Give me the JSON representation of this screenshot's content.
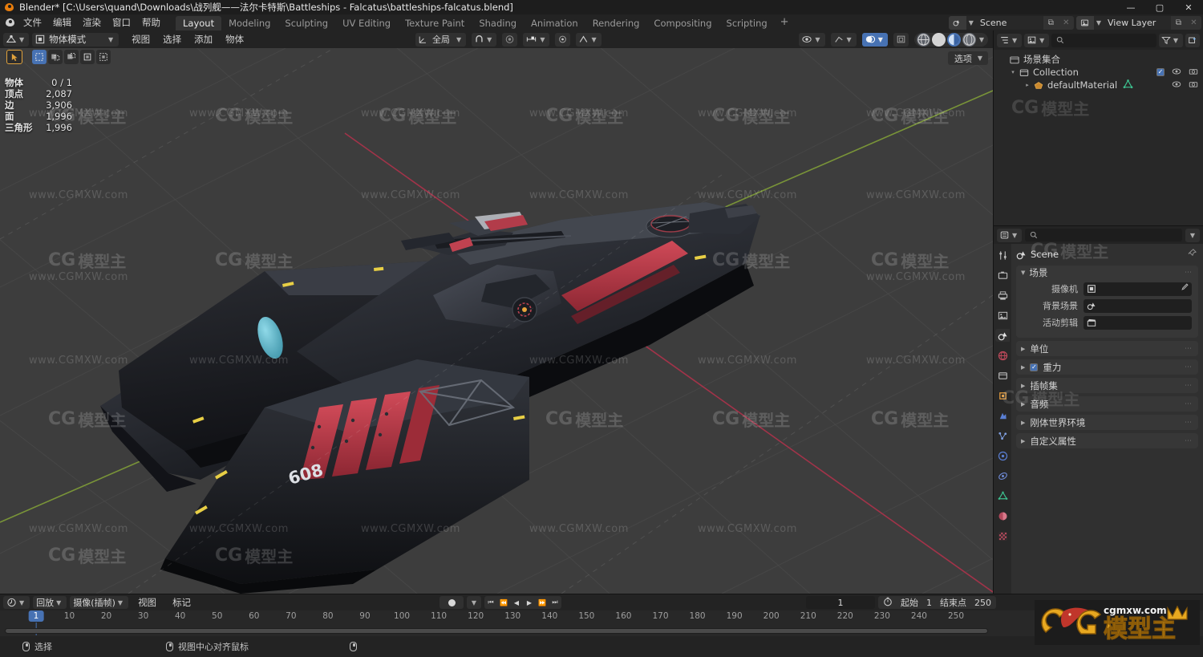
{
  "window": {
    "title": "Blender* [C:\\Users\\quand\\Downloads\\战列舰——法尔卡特斯\\Battleships - Falcatus\\battleships-falcatus.blend]",
    "minimize": "—",
    "maximize": "▢",
    "close": "✕"
  },
  "topbar": {
    "menus": [
      "文件",
      "编辑",
      "渲染",
      "窗口",
      "帮助"
    ],
    "workspaces": [
      {
        "label": "Layout",
        "active": true
      },
      {
        "label": "Modeling",
        "active": false
      },
      {
        "label": "Sculpting",
        "active": false
      },
      {
        "label": "UV Editing",
        "active": false
      },
      {
        "label": "Texture Paint",
        "active": false
      },
      {
        "label": "Shading",
        "active": false
      },
      {
        "label": "Animation",
        "active": false
      },
      {
        "label": "Rendering",
        "active": false
      },
      {
        "label": "Compositing",
        "active": false
      },
      {
        "label": "Scripting",
        "active": false
      }
    ],
    "add_workspace": "+",
    "scene_name": "Scene",
    "view_layer_name": "View Layer",
    "new_scene_label": "⧉",
    "unlink_label": "✕"
  },
  "viewport": {
    "mode": "物体模式",
    "menus": [
      "视图",
      "选择",
      "添加",
      "物体"
    ],
    "transform_orientation": "全局",
    "options_label": "选项",
    "stats": [
      {
        "key": "物体",
        "value": "0 / 1"
      },
      {
        "key": "顶点",
        "value": "2,087"
      },
      {
        "key": "边",
        "value": "3,906"
      },
      {
        "key": "面",
        "value": "1,996"
      },
      {
        "key": "三角形",
        "value": "1,996"
      }
    ],
    "shading_modes": [
      "wireframe",
      "solid",
      "material-preview",
      "rendered"
    ],
    "active_shading": "solid"
  },
  "outliner": {
    "search_placeholder": "",
    "rows": [
      {
        "name": "场景集合",
        "icon": "scene-collection-icon",
        "indent": 0,
        "tri": "",
        "has_toggles": false
      },
      {
        "name": "Collection",
        "icon": "collection-icon",
        "indent": 1,
        "tri": "▾",
        "has_toggles": true,
        "checkbox": true
      },
      {
        "name": "defaultMaterial",
        "icon": "mesh-object-icon",
        "indent": 2,
        "tri": "▸",
        "has_toggles": true,
        "checkbox": false
      }
    ],
    "eye_icon": "👁",
    "camera_icon": "📷",
    "filter_icon": "filter-icon",
    "new_collection_icon": "new-collection-icon"
  },
  "properties": {
    "search_placeholder": "",
    "breadcrumb": "Scene",
    "tabs": [
      "tool",
      "render",
      "output",
      "view-layer",
      "scene",
      "world",
      "collection",
      "object",
      "modifier",
      "particles",
      "physics",
      "constraints",
      "data",
      "material",
      "texture"
    ],
    "active_tab": "scene",
    "scene_panel": {
      "title": "场景",
      "fields": [
        {
          "label": "摄像机",
          "value": "",
          "icon": "camera-data-icon"
        },
        {
          "label": "背景场景",
          "value": "",
          "icon": "scene-icon"
        },
        {
          "label": "活动剪辑",
          "value": "",
          "icon": "clip-icon"
        }
      ]
    },
    "collapsed_panels": [
      {
        "label": "单位",
        "checkbox": false
      },
      {
        "label": "重力",
        "checkbox": true
      },
      {
        "label": "插帧集",
        "checkbox": false
      },
      {
        "label": "音频",
        "checkbox": false
      },
      {
        "label": "刚体世界环境",
        "checkbox": false
      },
      {
        "label": "自定义属性",
        "checkbox": false
      }
    ]
  },
  "timeline": {
    "editor_icon": "timeline-icon",
    "playback_label": "回放",
    "keying_label": "摄像(插帧)",
    "menus": [
      "视图",
      "标记"
    ],
    "transport": [
      "⏮",
      "⏪",
      "◀",
      "▶",
      "⏩",
      "⏭"
    ],
    "current_frame": "1",
    "start_label": "起始",
    "start_value": "1",
    "end_label": "结束点",
    "end_value": "250",
    "ruler_ticks": [
      10,
      20,
      30,
      40,
      50,
      60,
      70,
      80,
      90,
      100,
      110,
      120,
      130,
      140,
      150,
      160,
      170,
      180,
      190,
      200,
      210,
      220,
      230,
      240,
      250
    ],
    "playhead_frame": "1"
  },
  "statusbar": {
    "items": [
      {
        "mouse": "left",
        "label": "选择"
      },
      {
        "mouse": "middle",
        "label": "视图中心对齐鼠标"
      },
      {
        "mouse": "right",
        "label": ""
      }
    ]
  },
  "watermark": {
    "text": "www.CGMXW.com",
    "brand_cg": "CG",
    "brand_cn": "模型主",
    "brand_url": "cgmxw.com"
  },
  "colors": {
    "accent_blue": "#4772b3",
    "orange": "#e2a33c",
    "viewport_bg": "#3d3d3d",
    "panel_bg": "#303030",
    "header_bg": "#232323",
    "axis_x_red": "#c1344c",
    "axis_y_green": "#96b73c",
    "ship_red": "#c0394b",
    "ship_cyan": "#5ab4c8"
  }
}
